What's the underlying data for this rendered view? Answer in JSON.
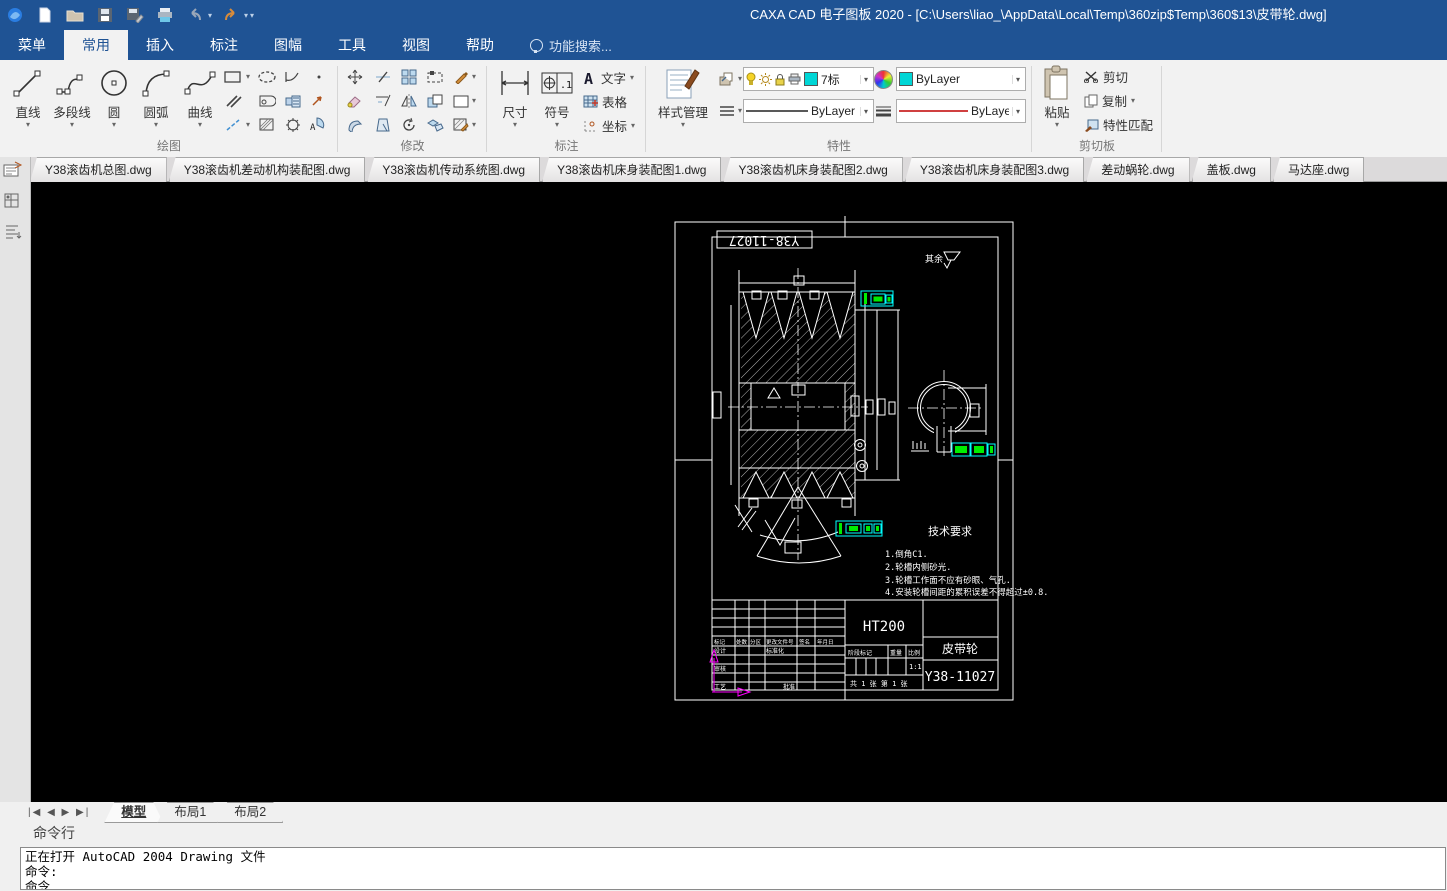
{
  "window": {
    "title": "CAXA CAD 电子图板 2020 - [C:\\Users\\liao_\\AppData\\Local\\Temp\\360zip$Temp\\360$13\\皮带轮.dwg]"
  },
  "menu": {
    "items": [
      "菜单",
      "常用",
      "插入",
      "标注",
      "图幅",
      "工具",
      "视图",
      "帮助"
    ],
    "active": "常用",
    "search_label": "功能搜索..."
  },
  "ribbon": {
    "draw": {
      "label": "绘图",
      "line": "直线",
      "polyline": "多段线",
      "circle": "圆",
      "arc": "圆弧",
      "curve": "曲线"
    },
    "modify": {
      "label": "修改"
    },
    "annotate": {
      "label": "标注",
      "dim": "尺寸",
      "symbol": "符号",
      "text": "文字",
      "table": "表格",
      "coord": "坐标"
    },
    "properties": {
      "label": "特性",
      "style_manager": "样式管理",
      "layer_name": "7标",
      "color_value": "ByLayer",
      "linetype_value": "ByLayer",
      "lineweight_value": "ByLayer"
    },
    "clipboard": {
      "label": "剪切板",
      "paste": "粘贴",
      "cut": "剪切",
      "copy": "复制",
      "match": "特性匹配"
    }
  },
  "doc_tabs": [
    "Y38滚齿机总图.dwg",
    "Y38滚齿机差动机构装配图.dwg",
    "Y38滚齿机传动系统图.dwg",
    "Y38滚齿机床身装配图1.dwg",
    "Y38滚齿机床身装配图2.dwg",
    "Y38滚齿机床身装配图3.dwg",
    "差动蜗轮.dwg",
    "盖板.dwg",
    "马达座.dwg"
  ],
  "drawing": {
    "frame_code": "Y38-11027",
    "surface_note": "其余",
    "tech_title": "技术要求",
    "tech_lines": [
      "1.倒角C1.",
      "2.轮槽内侧砂光.",
      "3.轮槽工作面不应有砂眼、气孔.",
      "4.安装轮槽间距的累积误差不得超过±0.8."
    ],
    "title_block": {
      "material": "HT200",
      "part_name": "皮带轮",
      "drawing_no": "Y38-11027",
      "scale": "1:1",
      "sheet": "共 1 张 第 1 张",
      "stage": "阶段标记",
      "weight": "重量",
      "ratio": "比例",
      "row_labels": [
        "标记",
        "处数",
        "分区",
        "更改文件号",
        "签名",
        "年月日"
      ],
      "designer": "设计",
      "standard": "标准化",
      "audit": "审核",
      "process": "工艺",
      "approve": "批准"
    },
    "colors": {
      "line": "#ffffff",
      "highlight": "#00ffff",
      "highlight_fill": "#00ee00",
      "ucs": "#ff00ff"
    }
  },
  "model_tabs": {
    "items": [
      "模型",
      "布局1",
      "布局2"
    ],
    "active": "模型"
  },
  "command": {
    "label": "命令行",
    "lines": [
      "正在打开 AutoCAD 2004 Drawing 文件",
      "命令:",
      "命令"
    ]
  }
}
